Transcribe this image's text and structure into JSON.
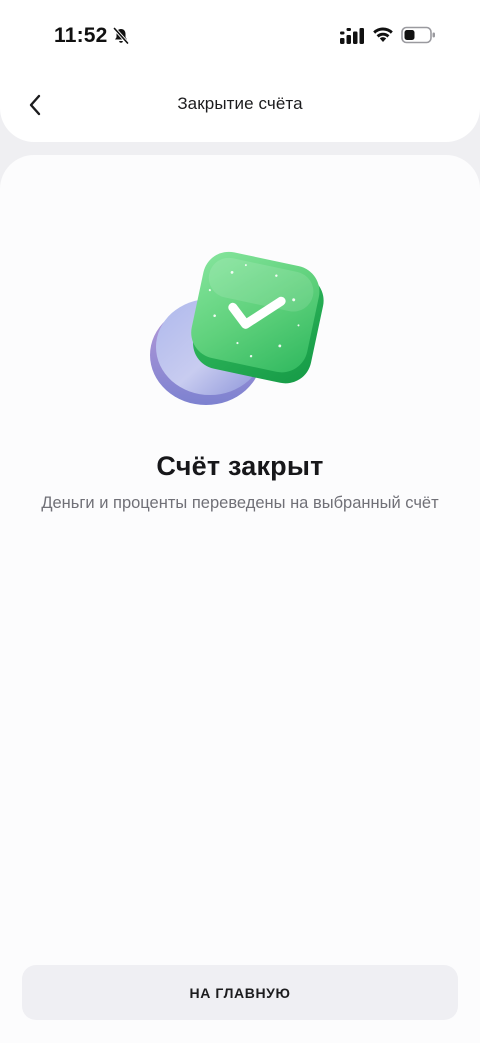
{
  "status_bar": {
    "time": "11:52",
    "icons": [
      "bell-slash-icon",
      "cellular-signal-icon",
      "wifi-icon",
      "battery-icon"
    ]
  },
  "nav": {
    "back_icon": "chevron-left-icon",
    "title": "Закрытие счёта"
  },
  "result": {
    "illustration": "green-check-card-illustration",
    "title": "Счёт закрыт",
    "subtitle": "Деньги и проценты переведены на выбранный счёт"
  },
  "actions": {
    "home_label": "НА ГЛАВНУЮ"
  },
  "colors": {
    "accent_green": "#3fc76d",
    "button_bg": "#efeff3",
    "page_bg": "#efeff2"
  }
}
